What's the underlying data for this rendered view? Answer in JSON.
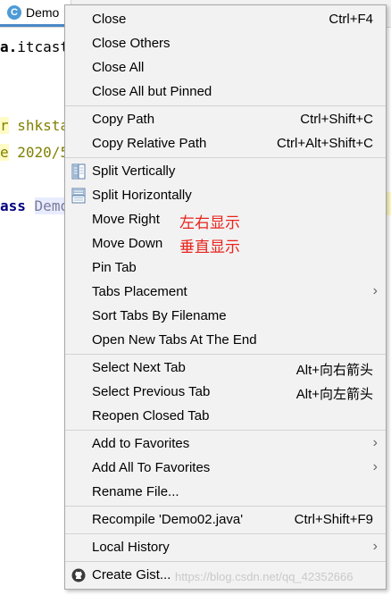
{
  "tab": {
    "icon_letter": "C",
    "label": "Demo"
  },
  "code": {
    "line1_prefix": "a.",
    "line1_rest": "itcast",
    "line2_prefix": "r",
    "line2_rest": " shksta",
    "line3_prefix": "e",
    "line3_rest": " 2020/5",
    "line4_keyword": "ass",
    "line4_class": "Demo"
  },
  "menu": {
    "items": [
      {
        "label": "Close",
        "shortcut": "Ctrl+F4"
      },
      {
        "label": "Close Others",
        "shortcut": ""
      },
      {
        "label": "Close All",
        "shortcut": ""
      },
      {
        "label": "Close All but Pinned",
        "shortcut": ""
      },
      {
        "label": "Copy Path",
        "shortcut": "Ctrl+Shift+C"
      },
      {
        "label": "Copy Relative Path",
        "shortcut": "Ctrl+Alt+Shift+C"
      },
      {
        "label": "Split Vertically",
        "shortcut": "",
        "icon": "split-vertically-icon"
      },
      {
        "label": "Split Horizontally",
        "shortcut": "",
        "icon": "split-horizontally-icon"
      },
      {
        "label": "Move Right",
        "shortcut": "",
        "note": "左右显示"
      },
      {
        "label": "Move Down",
        "shortcut": "",
        "note": "垂直显示"
      },
      {
        "label": "Pin Tab",
        "shortcut": ""
      },
      {
        "label": "Tabs Placement",
        "shortcut": "",
        "submenu": true
      },
      {
        "label": "Sort Tabs By Filename",
        "shortcut": ""
      },
      {
        "label": "Open New Tabs At The End",
        "shortcut": ""
      },
      {
        "label": "Select Next Tab",
        "shortcut": "Alt+向右箭头"
      },
      {
        "label": "Select Previous Tab",
        "shortcut": "Alt+向左箭头"
      },
      {
        "label": "Reopen Closed Tab",
        "shortcut": ""
      },
      {
        "label": "Add to Favorites",
        "shortcut": "",
        "submenu": true
      },
      {
        "label": "Add All To Favorites",
        "shortcut": "",
        "submenu": true
      },
      {
        "label": "Rename File...",
        "shortcut": ""
      },
      {
        "label": "Recompile 'Demo02.java'",
        "shortcut": "Ctrl+Shift+F9"
      },
      {
        "label": "Local History",
        "shortcut": "",
        "submenu": true
      },
      {
        "label": "Create Gist...",
        "shortcut": "",
        "icon": "github-icon"
      }
    ],
    "submenu_arrow": "›"
  },
  "watermark": "https://blog.csdn.net/qq_42352666"
}
